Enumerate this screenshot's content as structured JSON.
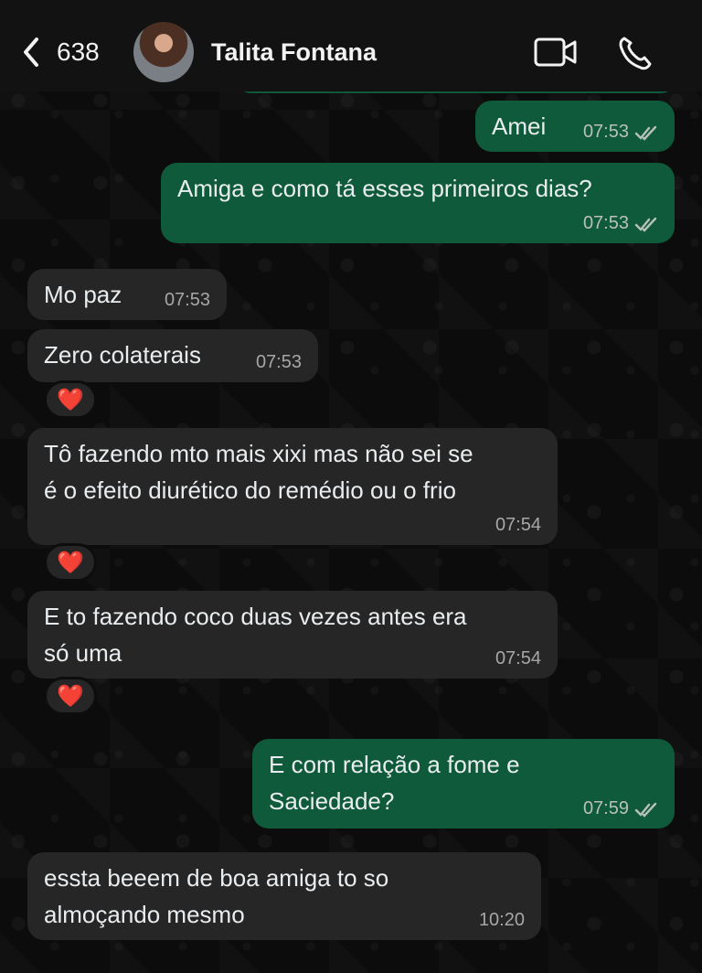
{
  "header": {
    "back_count": "638",
    "contact_name": "Talita Fontana",
    "icons": {
      "back": "chevron-left-icon",
      "avatar": "avatar",
      "video": "video-camera-icon",
      "call": "phone-icon"
    }
  },
  "messages": [
    {
      "direction": "sent",
      "text": "Amei",
      "time": "07:53",
      "status": "read"
    },
    {
      "direction": "sent",
      "text": "Amiga e como tá esses primeiros dias?",
      "time": "07:53",
      "status": "read"
    },
    {
      "direction": "received",
      "text": "Mo paz",
      "time": "07:53"
    },
    {
      "direction": "received",
      "text": "Zero colaterais",
      "time": "07:53",
      "reaction": "❤️"
    },
    {
      "direction": "received",
      "text": "Tô fazendo mto mais xixi mas não sei se\né o efeito diurético do remédio ou o frio",
      "time": "07:54",
      "reaction": "❤️"
    },
    {
      "direction": "received",
      "text": "E to fazendo coco duas vezes antes era\nsó uma",
      "time": "07:54",
      "reaction": "❤️"
    },
    {
      "direction": "sent",
      "text": "E com relação a fome e\nSaciedade?",
      "time": "07:59",
      "status": "read"
    },
    {
      "direction": "received",
      "text": "essta beeem de boa amiga to so\nalmoçando mesmo",
      "time": "10:20"
    }
  ],
  "colors": {
    "sent_bubble": "#0f5a3a",
    "received_bubble": "#262626",
    "background": "#0c0c0c",
    "reaction": "#ff2e4f"
  }
}
